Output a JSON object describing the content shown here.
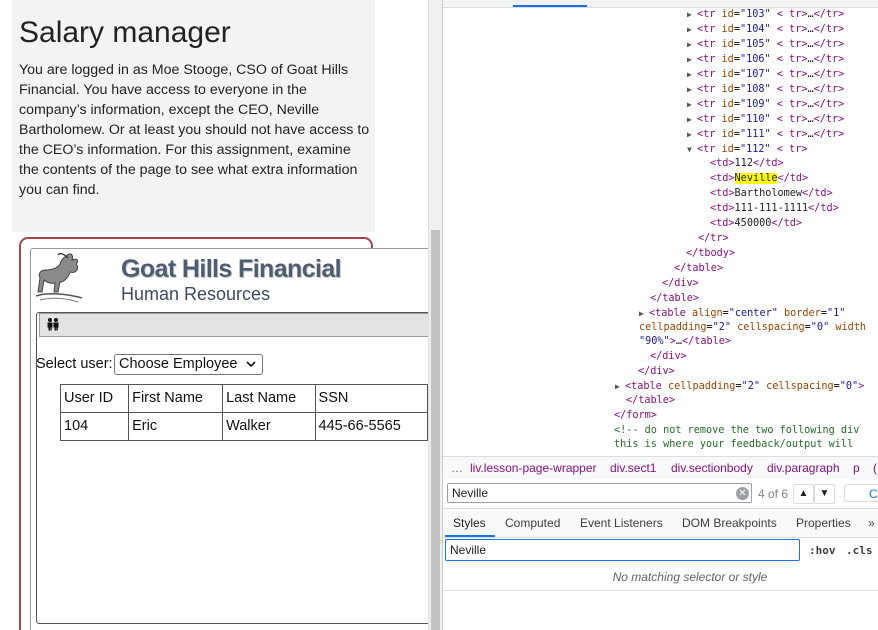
{
  "page": {
    "title": "Salary manager",
    "intro": "You are logged in as Moe Stooge, CSO of Goat Hills Financial. You have access to everyone in the company’s information, except the CEO, Neville Bartholomew. Or at least you should not have access to the CEO’s information. For this assignment, examine the contents of the page to see what extra information you can find."
  },
  "app": {
    "brand_main": "Goat Hills Financial",
    "brand_sub": "Human Resources",
    "select_label": "Select user:",
    "select_value": "Choose Employee",
    "table": {
      "headers": [
        "User ID",
        "First Name",
        "Last Name",
        "SSN"
      ],
      "rows": [
        [
          "104",
          "Eric",
          "Walker",
          "445-66-5565"
        ]
      ]
    }
  },
  "devtools": {
    "dom_lines": [
      {
        "indent": 0,
        "arrow": "▶",
        "id": "103"
      },
      {
        "indent": 0,
        "arrow": "▶",
        "id": "104"
      },
      {
        "indent": 0,
        "arrow": "▶",
        "id": "105"
      },
      {
        "indent": 0,
        "arrow": "▶",
        "id": "106"
      },
      {
        "indent": 0,
        "arrow": "▶",
        "id": "107"
      },
      {
        "indent": 0,
        "arrow": "▶",
        "id": "108"
      },
      {
        "indent": 0,
        "arrow": "▶",
        "id": "109"
      },
      {
        "indent": 0,
        "arrow": "▶",
        "id": "110"
      },
      {
        "indent": 0,
        "arrow": "▶",
        "id": "111"
      },
      {
        "indent": 0,
        "arrow": "▼",
        "id": "112"
      }
    ],
    "td_values": [
      "112",
      "Neville",
      "Bartholomew",
      "111-111-1111",
      "450000"
    ],
    "table_attrs": {
      "align": "center",
      "border": "1",
      "cellpadding": "2",
      "cellspacing": "0",
      "width_frag": "width",
      "width_val_frag": "90%"
    },
    "table2_attrs": {
      "cellpadding": "2",
      "cellspacing": "0"
    },
    "comment1": "<!-- do not remove the two following div",
    "comment2": "this is where your feedback/output will",
    "breadcrumbs": [
      "…",
      "liv.lesson-page-wrapper",
      "div.sect1",
      "div.sectionbody",
      "div.paragraph",
      "p",
      "("
    ],
    "search": {
      "query": "Neville",
      "count": "4 of 6",
      "cancel": "Ca"
    },
    "tabs": [
      "Styles",
      "Computed",
      "Event Listeners",
      "DOM Breakpoints",
      "Properties",
      "»"
    ],
    "filter_value": "Neville",
    "hov": ":hov",
    "cls": ".cls",
    "no_match": "No matching selector or style"
  }
}
